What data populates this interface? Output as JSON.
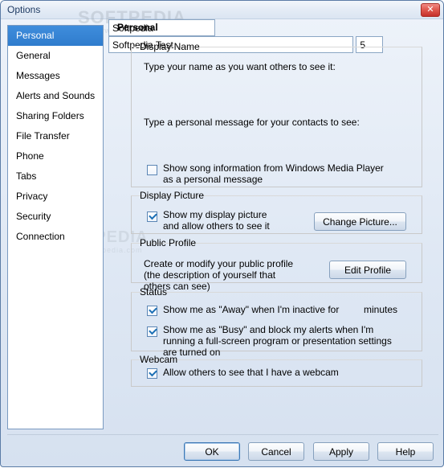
{
  "window": {
    "title": "Options",
    "close_icon": "close-icon",
    "close_label": "✕"
  },
  "watermark": {
    "brand": "SOFTPEDIA",
    "site": "www.softpedia.com"
  },
  "sidebar": {
    "items": [
      {
        "label": "Personal",
        "selected": true
      },
      {
        "label": "General",
        "selected": false
      },
      {
        "label": "Messages",
        "selected": false
      },
      {
        "label": "Alerts and Sounds",
        "selected": false
      },
      {
        "label": "Sharing Folders",
        "selected": false
      },
      {
        "label": "File Transfer",
        "selected": false
      },
      {
        "label": "Phone",
        "selected": false
      },
      {
        "label": "Tabs",
        "selected": false
      },
      {
        "label": "Privacy",
        "selected": false
      },
      {
        "label": "Security",
        "selected": false
      },
      {
        "label": "Connection",
        "selected": false
      }
    ]
  },
  "panel": {
    "title": "Personal",
    "display_name": {
      "group_label": "Display Name",
      "name_prompt": "Type your name as you want others to see it:",
      "name_value": "Softpedia",
      "message_prompt": "Type a personal message for your contacts to see:",
      "message_value": "Softpedia Test",
      "song_checkbox_label": "Show song information from Windows Media Player as a personal message",
      "song_checked": false
    },
    "display_picture": {
      "group_label": "Display Picture",
      "checkbox_label": "Show my display picture and allow others to see it",
      "checked": true,
      "button_label": "Change Picture..."
    },
    "public_profile": {
      "group_label": "Public Profile",
      "description": "Create or modify your public profile (the description of yourself that others can see)",
      "button_label": "Edit Profile"
    },
    "status": {
      "group_label": "Status",
      "away_label_before": "Show me as \"Away\" when I'm inactive for",
      "away_minutes": "5",
      "away_label_after": "minutes",
      "away_checked": true,
      "busy_label": "Show me as \"Busy\" and block my alerts when I'm running a full-screen program or presentation settings are turned on",
      "busy_checked": true
    },
    "webcam": {
      "group_label": "Webcam",
      "checkbox_label": "Allow others to see that I have a webcam",
      "checked": true
    }
  },
  "footer": {
    "ok_label": "OK",
    "cancel_label": "Cancel",
    "apply_label": "Apply",
    "help_label": "Help"
  },
  "colors": {
    "selection": "#2f7ccd",
    "title_text": "#1f3b63",
    "close_button": "#c5302b"
  }
}
